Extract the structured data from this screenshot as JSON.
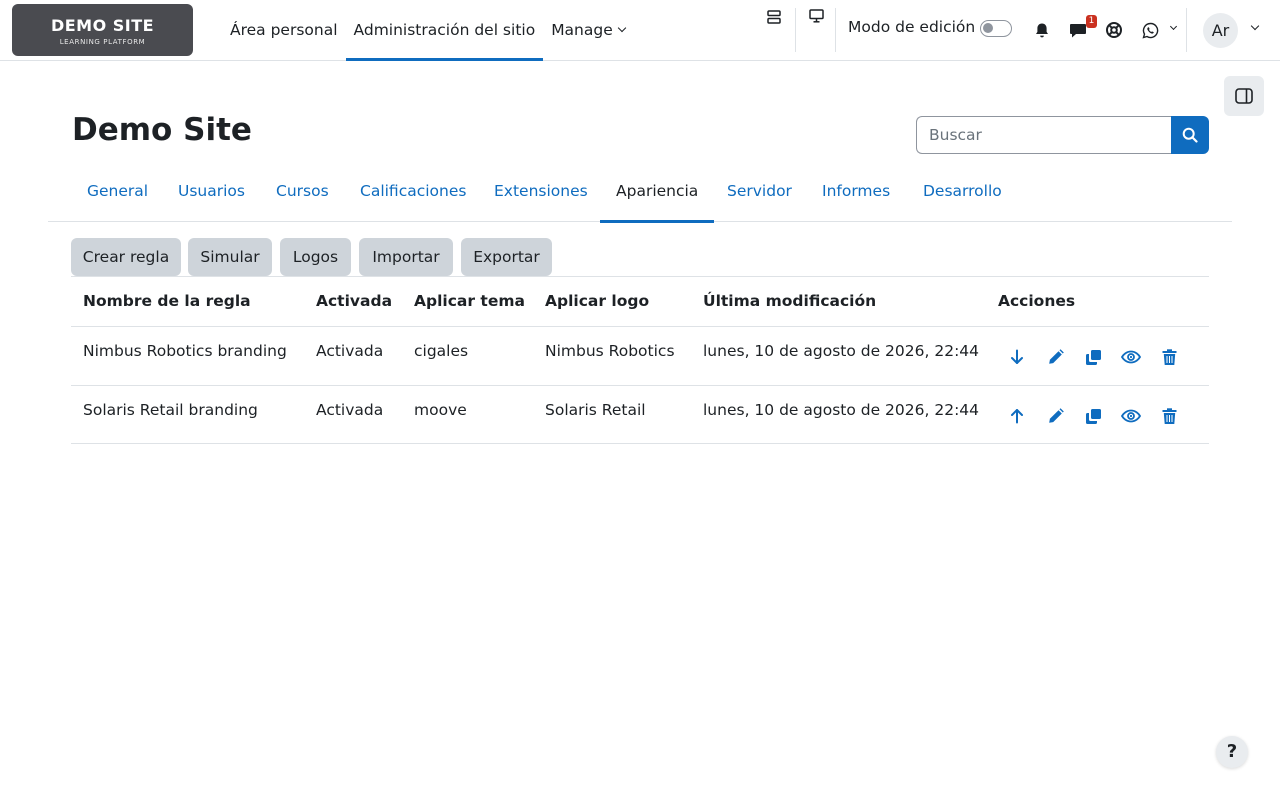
{
  "brand": {
    "name": "DEMO SITE",
    "tagline": "LEARNING PLATFORM"
  },
  "primary_nav": [
    {
      "label": "Área personal"
    },
    {
      "label": "Administración del sitio"
    },
    {
      "label": "Manage"
    }
  ],
  "header_actions": {
    "edit_mode_label": "Modo de edición",
    "edit_mode_on": false,
    "messages_badge": "1",
    "user_initials": "Ar"
  },
  "page": {
    "title": "Demo Site"
  },
  "search": {
    "placeholder": "Buscar"
  },
  "tabs": [
    {
      "label": "General"
    },
    {
      "label": "Usuarios"
    },
    {
      "label": "Cursos"
    },
    {
      "label": "Calificaciones"
    },
    {
      "label": "Extensiones"
    },
    {
      "label": "Apariencia"
    },
    {
      "label": "Servidor"
    },
    {
      "label": "Informes"
    },
    {
      "label": "Desarrollo"
    }
  ],
  "actions": [
    {
      "label": "Crear regla"
    },
    {
      "label": "Simular"
    },
    {
      "label": "Logos"
    },
    {
      "label": "Importar"
    },
    {
      "label": "Exportar"
    }
  ],
  "table": {
    "columns": [
      "Nombre de la regla",
      "Activada",
      "Aplicar tema",
      "Aplicar logo",
      "Última modificación",
      "Acciones"
    ],
    "rows": [
      {
        "name": "Nimbus Robotics branding",
        "enabled": "Activada",
        "theme": "cigales",
        "logo": "Nimbus Robotics",
        "modified": "lunes, 10 de agosto de 2026, 22:44"
      },
      {
        "name": "Solaris Retail branding",
        "enabled": "Activada",
        "theme": "moove",
        "logo": "Solaris Retail",
        "modified": "lunes, 10 de agosto de 2026, 22:44"
      }
    ]
  },
  "help": {
    "label": "?"
  },
  "colors": {
    "primary": "#0f6cbf",
    "text": "#1d2125",
    "border": "#dee2e6",
    "button_bg": "#ced4da",
    "badge": "#ca3120",
    "logo_bg": "#4a4b50"
  }
}
